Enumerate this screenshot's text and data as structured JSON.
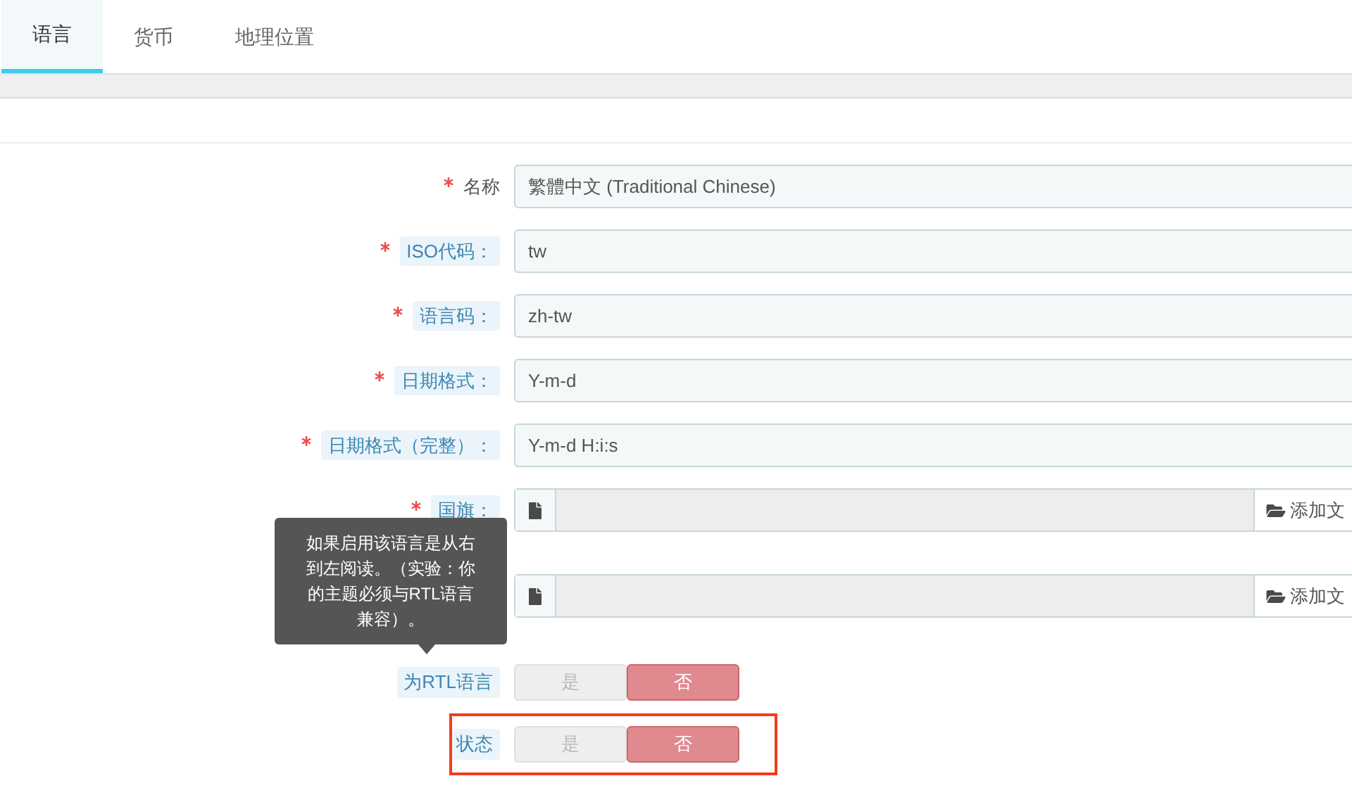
{
  "tabs": [
    {
      "label": "语言",
      "selected": true
    },
    {
      "label": "货币",
      "selected": false
    },
    {
      "label": "地理位置",
      "selected": false
    }
  ],
  "fields": [
    {
      "kind": "text",
      "label": "名称",
      "required": true,
      "chip": false,
      "value": "繁體中文 (Traditional Chinese)"
    },
    {
      "kind": "text",
      "label": "ISO代码：",
      "required": true,
      "chip": true,
      "value": "tw"
    },
    {
      "kind": "text",
      "label": "语言码：",
      "required": true,
      "chip": true,
      "value": "zh-tw"
    },
    {
      "kind": "text",
      "label": "日期格式：",
      "required": true,
      "chip": true,
      "value": "Y-m-d"
    },
    {
      "kind": "text",
      "label": "日期格式（完整）：",
      "required": true,
      "chip": true,
      "value": "Y-m-d H:i:s"
    },
    {
      "kind": "file",
      "label": "国旗：",
      "required": true,
      "chip": true,
      "button": "添加文"
    },
    {
      "kind": "file",
      "button": "添加文"
    }
  ],
  "toggles": [
    {
      "label": "为RTL语言",
      "highlighted": false,
      "tooltip": "如果启用该语言是从右到左阅读。（实验：你的主题必须与RTL语言兼容）。",
      "options": [
        {
          "label": "是",
          "selected": false
        },
        {
          "label": "否",
          "selected": true
        }
      ]
    },
    {
      "label": "状态",
      "highlighted": true,
      "options": [
        {
          "label": "是",
          "selected": false
        },
        {
          "label": "否",
          "selected": true
        }
      ]
    }
  ]
}
